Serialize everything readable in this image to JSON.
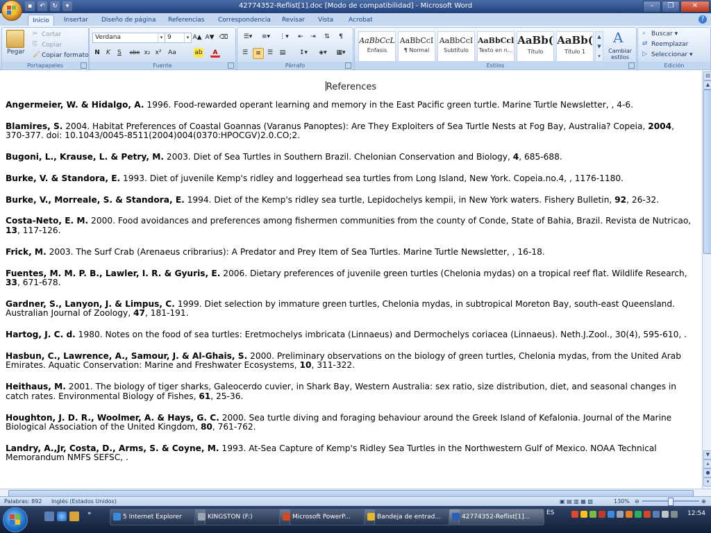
{
  "window": {
    "title": "42774352-Reflist[1].doc [Modo de compatibilidad] - Microsoft Word",
    "controls": [
      "–",
      "❐",
      "✕"
    ]
  },
  "tabs": [
    "Inicio",
    "Insertar",
    "Diseño de página",
    "Referencias",
    "Correspondencia",
    "Revisar",
    "Vista",
    "Acrobat"
  ],
  "ribbon": {
    "clipboard": {
      "paste": "Pegar",
      "cut": "Cortar",
      "copy": "Copiar",
      "format": "Copiar formato",
      "label": "Portapapeles"
    },
    "font": {
      "name": "Verdana",
      "size": "9",
      "label": "Fuente",
      "bold": "N",
      "italic": "K",
      "underline": "S",
      "strike": "abe",
      "sub": "x₂",
      "sup": "x²",
      "case": "Aa",
      "grow": "A▲",
      "shrink": "A▼"
    },
    "paragraph": {
      "label": "Párrafo"
    },
    "styles": {
      "label": "Estilos",
      "change": "Cambiar estilos",
      "items": [
        {
          "sample": "AaBbCcL",
          "name": "Énfasis"
        },
        {
          "sample": "AaBbCcI",
          "name": "¶ Normal"
        },
        {
          "sample": "AaBbCcI",
          "name": "Subtítulo"
        },
        {
          "sample": "AaBbCcl",
          "name": "Texto en n..."
        },
        {
          "sample": "AaBb(",
          "name": "Título"
        },
        {
          "sample": "AaBb(",
          "name": "Título 1"
        }
      ]
    },
    "editing": {
      "label": "Edición",
      "find": "Buscar",
      "replace": "Reemplazar",
      "select": "Seleccionar"
    }
  },
  "document": {
    "heading": "References",
    "references": [
      [
        {
          "b": "Angermeier, W. & Hidalgo, A."
        },
        {
          "t": " 1996. Food-rewarded operant learning and memory in the East Pacific green turtle. Marine Turtle Newsletter, , 4-6."
        }
      ],
      [
        {
          "b": "Blamires, S."
        },
        {
          "t": " 2004. Habitat Preferences of Coastal Goannas (Varanus Panoptes): Are They Exploiters of Sea Turtle Nests at Fog Bay, Australia? Copeia, "
        },
        {
          "b": "2004"
        },
        {
          "t": ", 370-377. doi: 10.1043/0045-8511(2004)004(0370:HPOCGV)2.0.CO;2."
        }
      ],
      [
        {
          "b": "Bugoni, L., Krause, L. & Petry, M."
        },
        {
          "t": " 2003. Diet of Sea Turtles in Southern Brazil. Chelonian Conservation and Biology, "
        },
        {
          "b": "4"
        },
        {
          "t": ", 685-688."
        }
      ],
      [
        {
          "b": "Burke, V. & Standora, E."
        },
        {
          "t": " 1993. Diet of juvenile Kemp's ridley and loggerhead sea turtles from Long Island, New York. Copeia.no.4, , 1176-1180."
        }
      ],
      [
        {
          "b": "Burke, V., Morreale, S. & Standora, E."
        },
        {
          "t": " 1994. Diet of the Kemp's ridley sea turtle, Lepidochelys kempii, in New York waters. Fishery Bulletin, "
        },
        {
          "b": "92"
        },
        {
          "t": ", 26-32."
        }
      ],
      [
        {
          "b": "Costa-Neto, E. M."
        },
        {
          "t": " 2000. Food avoidances and preferences among fishermen communities from the county of Conde, State of Bahia, Brazil. Revista de Nutricao, "
        },
        {
          "b": "13"
        },
        {
          "t": ", 117-126."
        }
      ],
      [
        {
          "b": "Frick, M."
        },
        {
          "t": " 2003. The Surf Crab (Arenaeus cribrarius): A Predator and Prey Item of Sea Turtles. Marine Turtle Newsletter, , 16-18."
        }
      ],
      [
        {
          "b": "Fuentes, M. M. P. B., Lawler, I. R. & Gyuris, E."
        },
        {
          "t": " 2006. Dietary preferences of juvenile green turtles (Chelonia mydas) on a tropical reef flat. Wildlife Research, "
        },
        {
          "b": "33"
        },
        {
          "t": ", 671-678."
        }
      ],
      [
        {
          "b": "Gardner, S., Lanyon, J. & Limpus, C."
        },
        {
          "t": " 1999. Diet selection by immature green turtles, Chelonia mydas, in subtropical Moreton Bay, south-east Queensland. Australian Journal of Zoology, "
        },
        {
          "b": "47"
        },
        {
          "t": ", 181-191."
        }
      ],
      [
        {
          "b": "Hartog, J. C. d."
        },
        {
          "t": " 1980. Notes on the food of sea turtles: Eretmochelys imbricata (Linnaeus) and Dermochelys coriacea (Linnaeus). Neth.J.Zool., 30(4), 595-610, ."
        }
      ],
      [
        {
          "b": "Hasbun, C., Lawrence, A., Samour, J. & Al-Ghais, S."
        },
        {
          "t": " 2000. Preliminary observations on the biology of green turtles, Chelonia mydas, from the United Arab Emirates. Aquatic Conservation: Marine and Freshwater Ecosystems, "
        },
        {
          "b": "10"
        },
        {
          "t": ", 311-322."
        }
      ],
      [
        {
          "b": "Heithaus, M."
        },
        {
          "t": " 2001. The biology of tiger sharks, Galeocerdo cuvier, in Shark Bay, Western Australia: sex ratio, size distribution, diet, and seasonal changes in catch rates. Environmental Biology of Fishes, "
        },
        {
          "b": "61"
        },
        {
          "t": ", 25-36."
        }
      ],
      [
        {
          "b": "Houghton, J. D. R., Woolmer, A. & Hays, G. C."
        },
        {
          "t": " 2000. Sea turtle diving and foraging behaviour around the Greek Island of Kefalonia. Journal of the Marine Biological Association of the United Kingdom, "
        },
        {
          "b": "80"
        },
        {
          "t": ", 761-762."
        }
      ],
      [
        {
          "b": "Landry, A.,Jr, Costa, D., Arms, S. & Coyne, M."
        },
        {
          "t": " 1993. At-Sea Capture of Kemp's Ridley Sea Turtles in the Northwestern Gulf of Mexico. NOAA Technical Memorandum NMFS SEFSC, ."
        }
      ]
    ]
  },
  "status": {
    "words": "Palabras: 892",
    "language": "Inglés (Estados Unidos)",
    "zoom": "130%"
  },
  "taskbar": {
    "buttons": [
      "5 Internet Explorer",
      "KINGSTON (F:)",
      "Microsoft PowerP...",
      "Bandeja de entrad...",
      "42774352-Reflist[1]..."
    ],
    "lang": "ES",
    "clock": "12:54"
  },
  "colors": {
    "accent": "#15428b",
    "ribbon": "#d2e1f4"
  }
}
